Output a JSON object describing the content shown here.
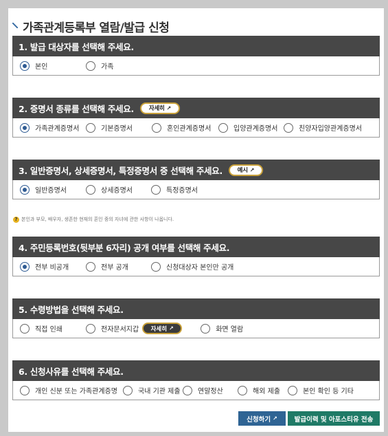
{
  "page_title": "가족관계등록부 열람/발급 신청",
  "sections": [
    {
      "heading": "1. 발급 대상자를 선택해 주세요.",
      "options": [
        "본인",
        "가족"
      ],
      "selected": 0
    },
    {
      "heading": "2. 증명서 종류를 선택해 주세요.",
      "link_label": "자세히",
      "options": [
        "가족관계증명서",
        "기본증명서",
        "혼인관계증명서",
        "입양관계증명서",
        "친양자입양관계증명서"
      ],
      "selected": 0
    },
    {
      "heading": "3. 일반증명서, 상세증명서, 특정증명서 중 선택해 주세요.",
      "link_label": "예시",
      "options": [
        "일반증명서",
        "상세증명서",
        "특정증명서"
      ],
      "selected": 0,
      "note": "본인과 부모, 배우자, 생존한 현재의 혼인 중의 자녀에 관한 사항이 나옵니다."
    },
    {
      "heading": "4. 주민등록번호(뒷부분 6자리) 공개 여부를 선택해 주세요.",
      "options": [
        "전부 비공개",
        "전부 공개",
        "신청대상자 본인만 공개"
      ],
      "selected": 0
    },
    {
      "heading": "5. 수령방법을 선택해 주세요.",
      "options": [
        "직접 인쇄",
        "전자문서지갑",
        "화면 열람"
      ],
      "link_label": "자세히",
      "selected": -1
    },
    {
      "heading": "6. 신청사유를 선택해 주세요.",
      "options": [
        "개인 신분 또는 가족관계증명",
        "국내 기관 제출",
        "연말정산",
        "해외 제출",
        "본인 확인 등 기타"
      ],
      "selected": -1
    }
  ],
  "buttons": {
    "apply": "신청하기",
    "history": "발급이력 및 아포스티유 전송"
  },
  "colors": {
    "header_bg": "#474747",
    "radio_selected": "#2f5b93",
    "pill_border": "#c9a13a",
    "apply_button": "#2f6494",
    "history_button": "#1f7a66"
  }
}
